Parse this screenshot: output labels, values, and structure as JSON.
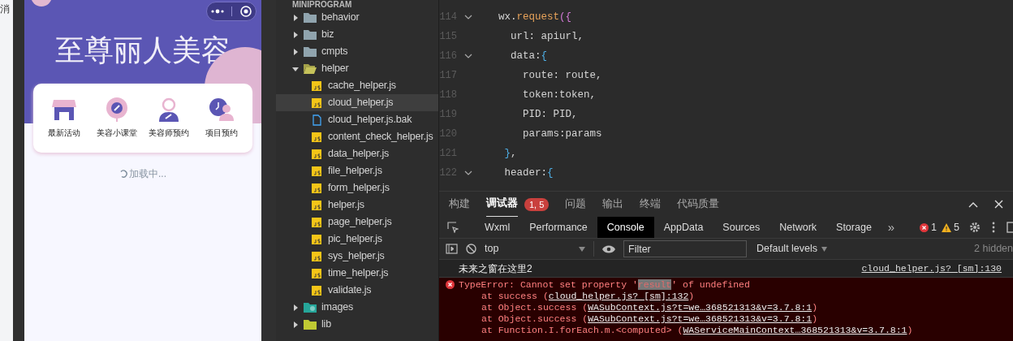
{
  "side_strip": {
    "text": "消"
  },
  "phone": {
    "title": "至尊丽人美容",
    "menu": [
      {
        "label": "最新活动",
        "kind": "shop"
      },
      {
        "label": "美容小课堂",
        "kind": "mirror"
      },
      {
        "label": "美容师预约",
        "kind": "person"
      },
      {
        "label": "项目预约",
        "kind": "clock"
      }
    ],
    "loading": "加载中..."
  },
  "explorer": {
    "header": "MINIPROGRAM",
    "items": [
      {
        "name": "behavior",
        "kind": "folder",
        "expanded": false,
        "selected": false
      },
      {
        "name": "biz",
        "kind": "folder",
        "expanded": false,
        "selected": false
      },
      {
        "name": "cmpts",
        "kind": "folder",
        "expanded": false,
        "selected": false
      },
      {
        "name": "helper",
        "kind": "folder",
        "expanded": true,
        "selected": false,
        "children": [
          {
            "name": "cache_helper.js",
            "kind": "js",
            "selected": false
          },
          {
            "name": "cloud_helper.js",
            "kind": "js",
            "selected": true
          },
          {
            "name": "cloud_helper.js.bak",
            "kind": "file",
            "selected": false
          },
          {
            "name": "content_check_helper.js",
            "kind": "js",
            "selected": false
          },
          {
            "name": "data_helper.js",
            "kind": "js",
            "selected": false
          },
          {
            "name": "file_helper.js",
            "kind": "js",
            "selected": false
          },
          {
            "name": "form_helper.js",
            "kind": "js",
            "selected": false
          },
          {
            "name": "helper.js",
            "kind": "js",
            "selected": false
          },
          {
            "name": "page_helper.js",
            "kind": "js",
            "selected": false
          },
          {
            "name": "pic_helper.js",
            "kind": "js",
            "selected": false
          },
          {
            "name": "sys_helper.js",
            "kind": "js",
            "selected": false
          },
          {
            "name": "time_helper.js",
            "kind": "js",
            "selected": false
          },
          {
            "name": "validate.js",
            "kind": "js",
            "selected": false
          }
        ]
      },
      {
        "name": "images",
        "kind": "images",
        "expanded": false,
        "selected": false
      },
      {
        "name": "lib",
        "kind": "lib",
        "expanded": false,
        "selected": false
      }
    ]
  },
  "editor": {
    "lines": [
      {
        "number": "114",
        "foldable": true,
        "tokens": [
          {
            "text": "wx.",
            "kind": "plain"
          },
          {
            "text": "request",
            "kind": "method"
          },
          {
            "text": "({",
            "kind": "paren"
          }
        ]
      },
      {
        "number": "115",
        "foldable": false,
        "tokens": [
          {
            "text": "  url: apiurl,",
            "kind": "plain"
          }
        ]
      },
      {
        "number": "116",
        "foldable": true,
        "tokens": [
          {
            "text": "  data:",
            "kind": "plain"
          },
          {
            "text": "{",
            "kind": "brace"
          }
        ]
      },
      {
        "number": "117",
        "foldable": false,
        "tokens": [
          {
            "text": "    route: route,",
            "kind": "plain"
          }
        ]
      },
      {
        "number": "118",
        "foldable": false,
        "tokens": [
          {
            "text": "    token:token,",
            "kind": "plain"
          }
        ]
      },
      {
        "number": "119",
        "foldable": false,
        "tokens": [
          {
            "text": "    PID: PID,",
            "kind": "plain"
          }
        ]
      },
      {
        "number": "120",
        "foldable": false,
        "tokens": [
          {
            "text": "    params:params",
            "kind": "plain"
          }
        ]
      },
      {
        "number": "121",
        "foldable": false,
        "tokens": [
          {
            "text": " }",
            "kind": "brace"
          },
          {
            "text": ",",
            "kind": "plain"
          }
        ]
      },
      {
        "number": "122",
        "foldable": true,
        "tokens": [
          {
            "text": " header:",
            "kind": "plain"
          },
          {
            "text": "{",
            "kind": "brace"
          }
        ]
      }
    ]
  },
  "devtools": {
    "tabs": [
      {
        "label": "构建",
        "selected": false
      },
      {
        "label": "调试器",
        "selected": true,
        "badge": "1, 5"
      },
      {
        "label": "问题",
        "selected": false
      },
      {
        "label": "输出",
        "selected": false
      },
      {
        "label": "终端",
        "selected": false
      },
      {
        "label": "代码质量",
        "selected": false
      }
    ],
    "panels": [
      {
        "label": "Wxml",
        "selected": false
      },
      {
        "label": "Performance",
        "selected": false
      },
      {
        "label": "Console",
        "selected": true
      },
      {
        "label": "AppData",
        "selected": false
      },
      {
        "label": "Sources",
        "selected": false
      },
      {
        "label": "Network",
        "selected": false
      },
      {
        "label": "Storage",
        "selected": false
      }
    ],
    "more": "»",
    "errors": "1",
    "warnings": "5",
    "context": "top",
    "filter": {
      "placeholder": "Filter"
    },
    "levels": "Default levels",
    "hidden": "2 hidden",
    "messages": [
      {
        "kind": "log",
        "text": "未来之窗在这里2",
        "source": "cloud_helper.js? [sm]:130"
      },
      {
        "kind": "error",
        "before": "TypeError: Cannot set property '",
        "highlight": "result",
        "after": "' of undefined",
        "stack": [
          {
            "text": "at success (",
            "link": "cloud_helper.js? [sm]:132",
            "end": ")"
          },
          {
            "text": "at Object.success (",
            "link": "WASubContext.js?t=we…368521313&v=3.7.8:1",
            "end": ")"
          },
          {
            "text": "at Object.success (",
            "link": "WASubContext.js?t=we…368521313&v=3.7.8:1",
            "end": ")"
          },
          {
            "text": "at Function.I.forEach.m.<computed> (",
            "link": "WAServiceMainContext…368521313&v=3.7.8:1",
            "end": ")"
          }
        ]
      }
    ]
  }
}
